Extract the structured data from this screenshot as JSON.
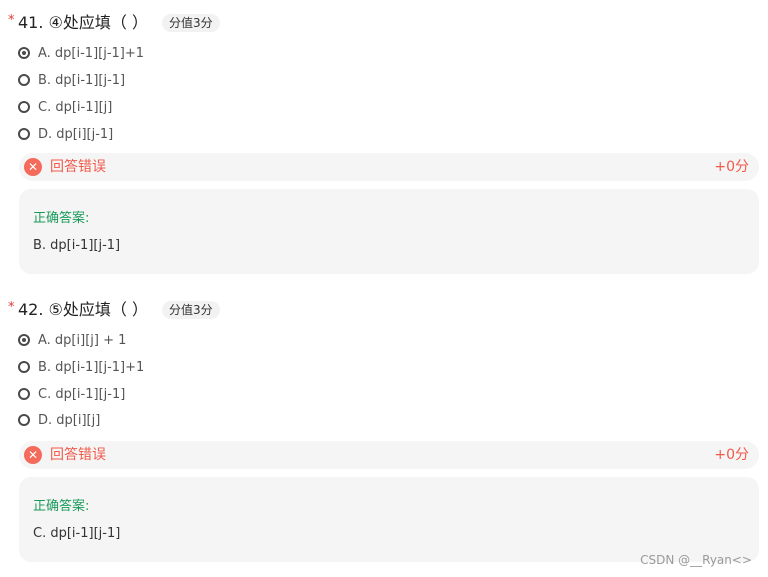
{
  "questions": [
    {
      "star": "*",
      "title": "41. ④处应填（ ）",
      "score_badge": "分值3分",
      "options": [
        {
          "text": "A. dp[i-1][j-1]+1",
          "checked": true
        },
        {
          "text": "B. dp[i-1][j-1]",
          "checked": false
        },
        {
          "text": "C. dp[i-1][j]",
          "checked": false
        },
        {
          "text": "D. dp[i][j-1]",
          "checked": false
        }
      ],
      "result_text": "回答错误",
      "result_score": "+0分",
      "answer_label": "正确答案:",
      "answer_value": "B. dp[i-1][j-1]"
    },
    {
      "star": "*",
      "title": "42. ⑤处应填（ ）",
      "score_badge": "分值3分",
      "options": [
        {
          "text": "A. dp[i][j] + 1",
          "checked": true
        },
        {
          "text": "B. dp[i-1][j-1]+1",
          "checked": false
        },
        {
          "text": "C. dp[i-1][j-1]",
          "checked": false
        },
        {
          "text": "D. dp[i][j]",
          "checked": false
        }
      ],
      "result_text": "回答错误",
      "result_score": "+0分",
      "answer_label": "正确答案:",
      "answer_value": "C. dp[i-1][j-1]"
    }
  ],
  "watermark": "CSDN @__Ryan<>",
  "colors": {
    "wrong": "#f05a4a",
    "correct_label": "#1a9a5a"
  }
}
